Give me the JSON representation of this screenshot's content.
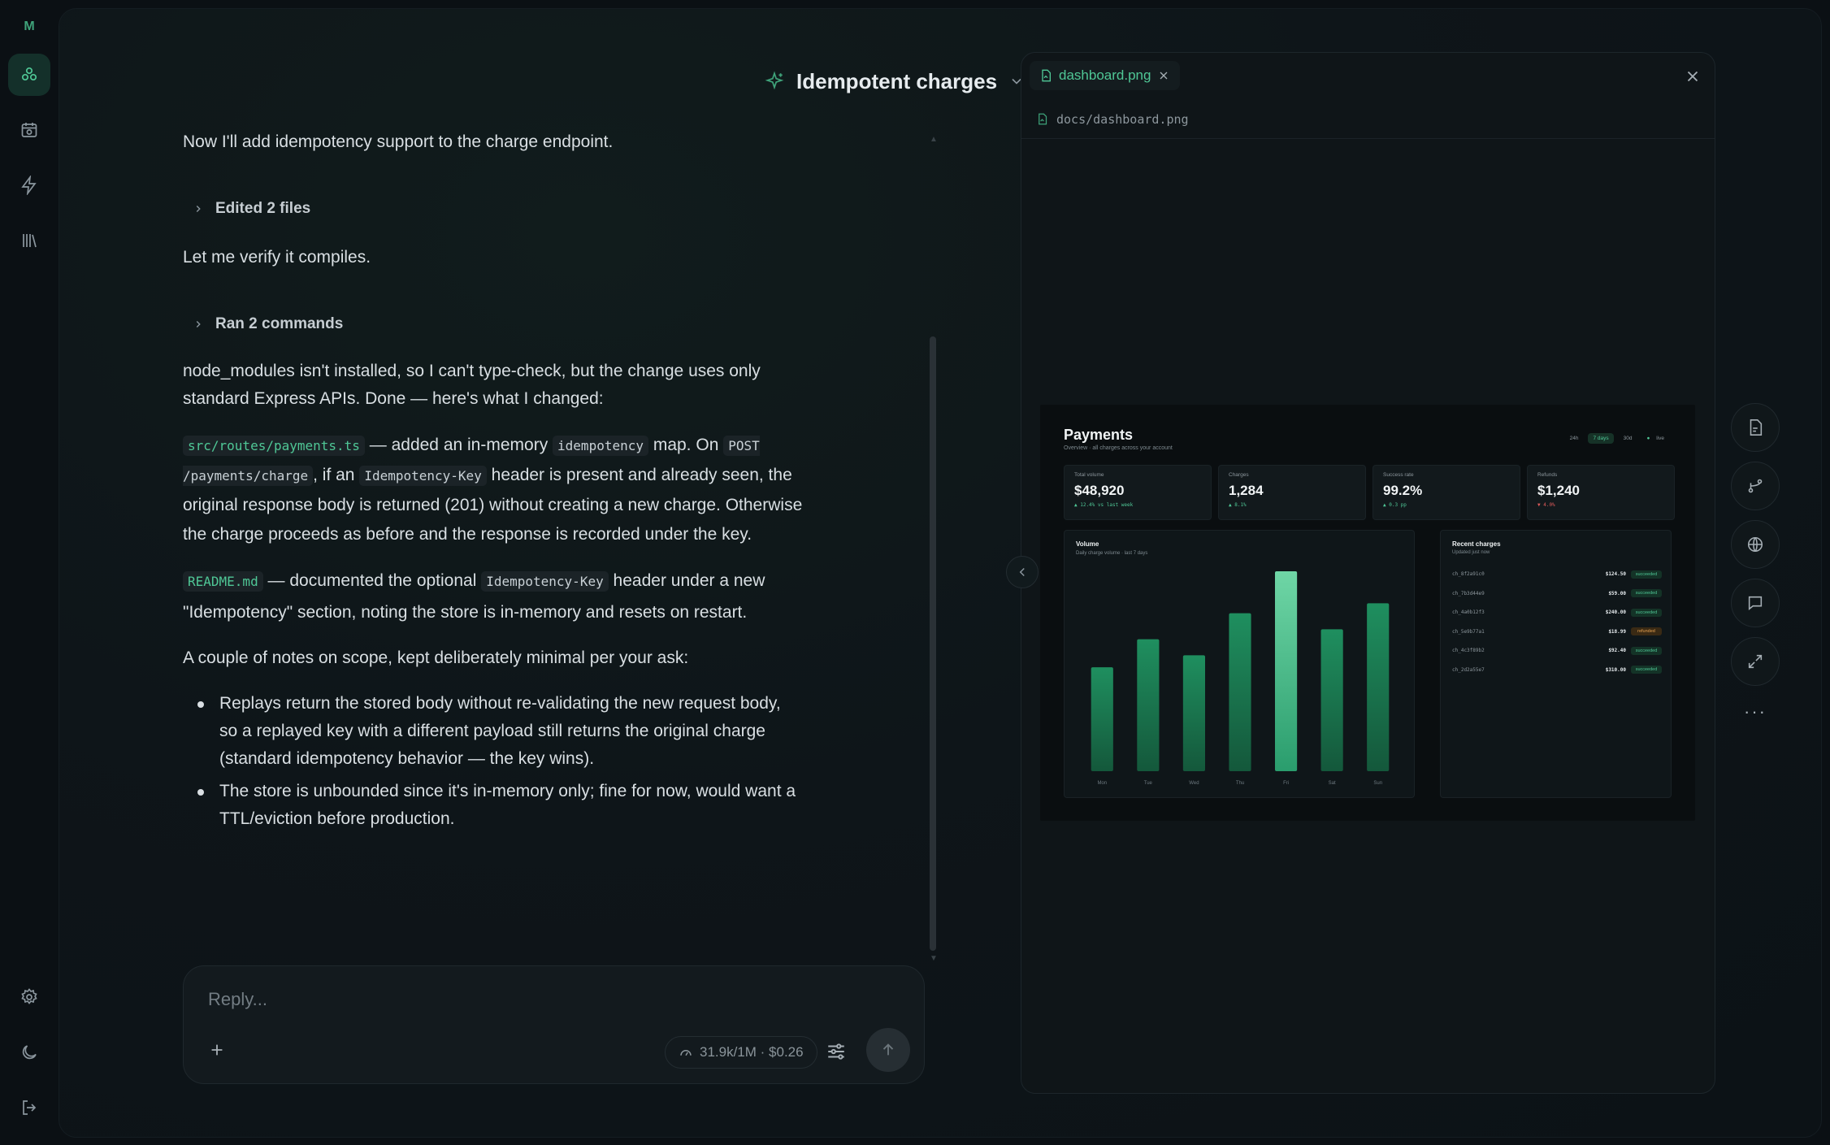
{
  "app": {
    "logo_letter": "M"
  },
  "rail": {
    "items": [
      "projects-icon",
      "calendar-icon",
      "bolt-icon",
      "library-icon"
    ],
    "bottom": [
      "settings-icon",
      "moon-icon",
      "logout-icon"
    ]
  },
  "chat": {
    "title": "Idempotent charges",
    "intro": "Now I'll add idempotency support to the charge endpoint.",
    "edited_label": "Edited 2 files",
    "verify": "Let me verify it compiles.",
    "ran_label": "Ran 2 commands",
    "summary": "node_modules isn't installed, so I can't type-check, but the change uses only standard Express APIs. Done — here's what I changed:",
    "change1": {
      "file": "src/routes/payments.ts",
      "t1": " — added an in-memory ",
      "code1": "idempotency",
      "t2": " map. On ",
      "code2": "POST /payments/charge",
      "t3": ", if an ",
      "code3": "Idempotency-Key",
      "t4": " header is present and already seen, the original response body is returned (201) without creating a new charge. Otherwise the charge proceeds as before and the response is recorded under the key."
    },
    "change2": {
      "file": "README.md",
      "t1": " — documented the optional ",
      "code1": "Idempotency-Key",
      "t2": " header under a new \"Idempotency\" section, noting the store is in-memory and resets on restart."
    },
    "notes_intro": "A couple of notes on scope, kept deliberately minimal per your ask:",
    "bullets": [
      "Replays return the stored body without re-validating the new request body, so a replayed key with a different payload still returns the original charge (standard idempotency behavior — the key wins).",
      "The store is unbounded since it's in-memory only; fine for now, would want a TTL/eviction before production."
    ]
  },
  "composer": {
    "placeholder": "Reply...",
    "usage": "31.9k/1M · $0.26"
  },
  "panel": {
    "tab_label": "dashboard.png",
    "path": "docs/dashboard.png",
    "actions": [
      "file-icon",
      "branch-icon",
      "globe-icon",
      "comment-icon",
      "expand-icon"
    ]
  },
  "dashboard": {
    "title": "Payments",
    "subtitle": "Overview · all charges across your account",
    "ranges": [
      "24h",
      "7 days",
      "30d"
    ],
    "active_range": "7 days",
    "live_label": "live",
    "kpis": [
      {
        "label": "Total volume",
        "value": "$48,920",
        "delta": "▲ 12.4% vs last week",
        "dir": "up"
      },
      {
        "label": "Charges",
        "value": "1,284",
        "delta": "▲ 8.1%",
        "dir": "up"
      },
      {
        "label": "Success rate",
        "value": "99.2%",
        "delta": "▲ 0.3 pp",
        "dir": "up"
      },
      {
        "label": "Refunds",
        "value": "$1,240",
        "delta": "▼ 4.0%",
        "dir": "down"
      }
    ],
    "volume_title": "Volume",
    "volume_subtitle": "Daily charge volume · last 7 days",
    "recent_title": "Recent charges",
    "recent_subtitle": "Updated just now",
    "recent": [
      {
        "id": "ch_8f2a91c0",
        "amount": "$124.50",
        "status": "succeeded"
      },
      {
        "id": "ch_7b3d44e9",
        "amount": "$59.00",
        "status": "succeeded"
      },
      {
        "id": "ch_4a0b12f3",
        "amount": "$240.00",
        "status": "succeeded"
      },
      {
        "id": "ch_5e9b77a1",
        "amount": "$18.99",
        "status": "refunded"
      },
      {
        "id": "ch_4c3f89b2",
        "amount": "$92.40",
        "status": "succeeded"
      },
      {
        "id": "ch_2d2a55e7",
        "amount": "$310.00",
        "status": "succeeded"
      }
    ]
  },
  "chart_data": {
    "type": "bar",
    "title": "Volume",
    "categories": [
      "Mon",
      "Tue",
      "Wed",
      "Thu",
      "Fri",
      "Sat",
      "Sun"
    ],
    "values": [
      52,
      66,
      58,
      79,
      100,
      71,
      84
    ],
    "ylim": [
      0,
      100
    ],
    "highlight_index": 4,
    "colors": {
      "bar": "#1f8f5f",
      "highlight": "#6fd6a6"
    }
  }
}
